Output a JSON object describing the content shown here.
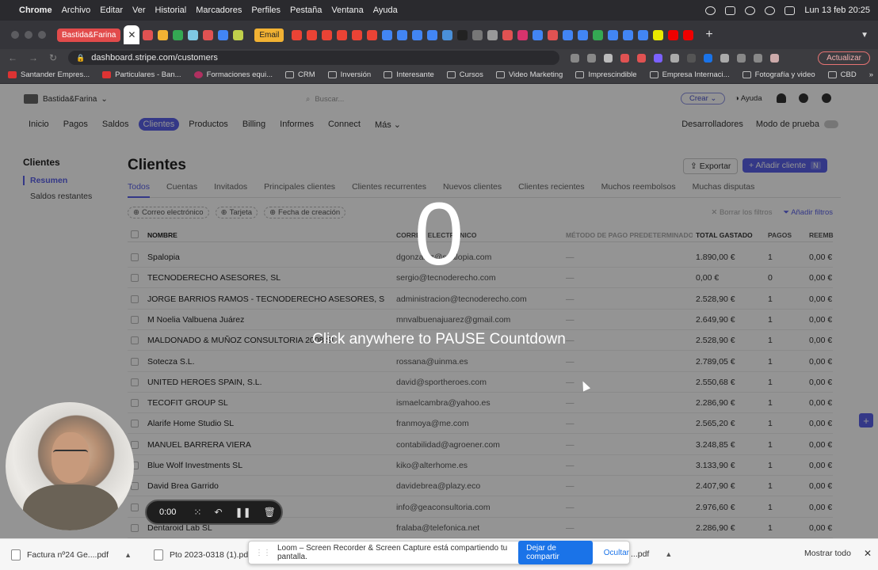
{
  "menubar": {
    "app": "Chrome",
    "items": [
      "Archivo",
      "Editar",
      "Ver",
      "Historial",
      "Marcadores",
      "Perfiles",
      "Pestaña",
      "Ventana",
      "Ayuda"
    ],
    "clock": "Lun 13 feb 20:25"
  },
  "tabs": {
    "group1": "Bastida&Farina",
    "group2": "Email",
    "close_glyph": "✕",
    "new_tab": "+"
  },
  "address": {
    "url": "dashboard.stripe.com/customers",
    "update_label": "Actualizar"
  },
  "bookmarks": [
    "Santander Empres...",
    "Particulares - Ban...",
    "Formaciones equi...",
    "CRM",
    "Inversión",
    "Interesante",
    "Cursos",
    "Video Marketing",
    "Imprescindible",
    "Empresa Internaci...",
    "Fotografía y video",
    "CBD"
  ],
  "stripe": {
    "account": "Bastida&Farina",
    "search_placeholder": "Buscar...",
    "crear": "Crear",
    "ayuda": "Ayuda",
    "nav": [
      "Inicio",
      "Pagos",
      "Saldos",
      "Clientes",
      "Productos",
      "Billing",
      "Informes",
      "Connect",
      "Más"
    ],
    "developers": "Desarrolladores",
    "test_mode": "Modo de prueba",
    "left_heading": "Clientes",
    "left_items": [
      "Resumen",
      "Saldos restantes"
    ],
    "title": "Clientes",
    "export": "Exportar",
    "add_customer": "Añadir cliente",
    "add_kbd": "N",
    "tabs": [
      "Todos",
      "Cuentas",
      "Invitados",
      "Principales clientes",
      "Clientes recurrentes",
      "Nuevos clientes",
      "Clientes recientes",
      "Muchos reembolsos",
      "Muchas disputas"
    ],
    "filters": [
      "Correo electrónico",
      "Tarjeta",
      "Fecha de creación"
    ],
    "clear_filters": "Borrar los filtros",
    "add_filters": "Añadir filtros",
    "columns": [
      "NOMBRE",
      "CORREO ELECTRÓNICO",
      "MÉTODO DE PAGO PREDETERMINADO",
      "TOTAL GASTADO",
      "PAGOS",
      "REEMB"
    ],
    "rows": [
      {
        "name": "Spalopia",
        "email": "dgonzalez@spalopia.com",
        "pay": "—",
        "spent": "1.890,00 €",
        "payments": "1",
        "refunds": "0,00 €"
      },
      {
        "name": "TECNODERECHO ASESORES, SL",
        "email": "sergio@tecnoderecho.com",
        "pay": "—",
        "spent": "0,00 €",
        "payments": "0",
        "refunds": "0,00 €"
      },
      {
        "name": "JORGE BARRIOS RAMOS - TECNODERECHO ASESORES, SL",
        "email": "administracion@tecnoderecho.com",
        "pay": "—",
        "spent": "2.528,90 €",
        "payments": "1",
        "refunds": "0,00 €"
      },
      {
        "name": "M Noelia Valbuena Juárez",
        "email": "mnvalbuenajuarez@gmail.com",
        "pay": "—",
        "spent": "2.649,90 €",
        "payments": "1",
        "refunds": "0,00 €"
      },
      {
        "name": "MALDONADO & MUÑOZ CONSULTORIA 2008 SL",
        "email": "",
        "pay": "—",
        "spent": "2.528,90 €",
        "payments": "1",
        "refunds": "0,00 €"
      },
      {
        "name": "Sotecza S.L.",
        "email": "rossana@uinma.es",
        "pay": "—",
        "spent": "2.789,05 €",
        "payments": "1",
        "refunds": "0,00 €"
      },
      {
        "name": "UNITED HEROES SPAIN, S.L.",
        "email": "david@sportheroes.com",
        "pay": "—",
        "spent": "2.550,68 €",
        "payments": "1",
        "refunds": "0,00 €"
      },
      {
        "name": "TECOFIT GROUP SL",
        "email": "ismaelcambra@yahoo.es",
        "pay": "—",
        "spent": "2.286,90 €",
        "payments": "1",
        "refunds": "0,00 €"
      },
      {
        "name": "Alarife Home Studio SL",
        "email": "franmoya@me.com",
        "pay": "—",
        "spent": "2.565,20 €",
        "payments": "1",
        "refunds": "0,00 €"
      },
      {
        "name": "MANUEL BARRERA VIERA",
        "email": "contabilidad@agroener.com",
        "pay": "—",
        "spent": "3.248,85 €",
        "payments": "1",
        "refunds": "0,00 €"
      },
      {
        "name": "Blue Wolf Investments SL",
        "email": "kiko@alterhome.es",
        "pay": "—",
        "spent": "3.133,90 €",
        "payments": "1",
        "refunds": "0,00 €"
      },
      {
        "name": "David Brea Garrido",
        "email": "davidebrea@plazy.eco",
        "pay": "—",
        "spent": "2.407,90 €",
        "payments": "1",
        "refunds": "0,00 €"
      },
      {
        "name": "",
        "email": "info@geaconsultoria.com",
        "pay": "—",
        "spent": "2.976,60 €",
        "payments": "1",
        "refunds": "0,00 €"
      },
      {
        "name": "Dentaroid Lab SL",
        "email": "fralaba@telefonica.net",
        "pay": "—",
        "spent": "2.286,90 €",
        "payments": "1",
        "refunds": "0,00 €"
      }
    ]
  },
  "overlay": {
    "countdown": "0",
    "message": "Click anywhere to PAUSE Countdown"
  },
  "recorder": {
    "time": "0:00"
  },
  "downloads": {
    "files": [
      "Factura nº24 Ge....pdf",
      "Pto 2023-0318 (1).pdf"
    ],
    "hidden_file_suffix": "...pdf",
    "show_all": "Mostrar todo"
  },
  "loom": {
    "message": "Loom – Screen Recorder & Screen Capture está compartiendo tu pantalla.",
    "stop": "Dejar de compartir",
    "hide": "Ocultar"
  },
  "colors": {
    "stripe_accent": "#5b61e8",
    "chrome_dark": "#35353a",
    "tab_group_red": "#e24b4b",
    "tab_group_yellow": "#f2b233"
  }
}
